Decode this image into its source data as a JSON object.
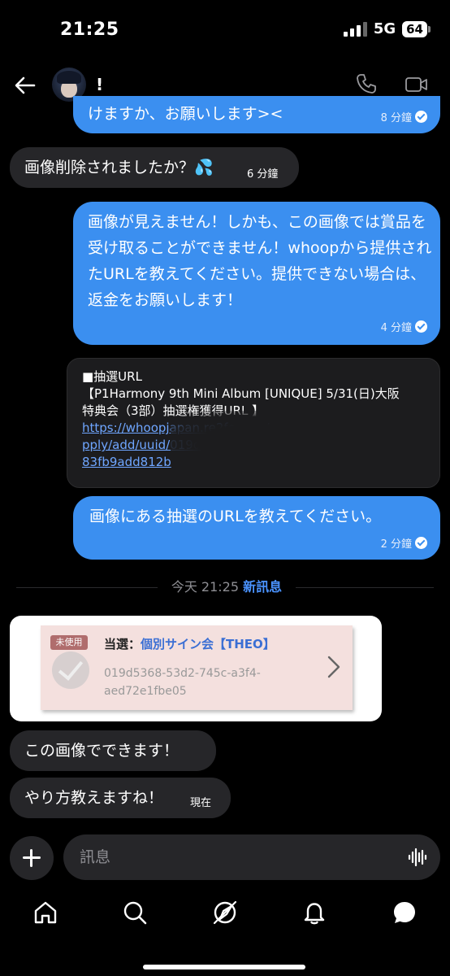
{
  "status_bar": {
    "time": "21:25",
    "network": "5G",
    "battery": "64"
  },
  "header": {
    "contact_name": "!"
  },
  "messages": [
    {
      "from": "me",
      "text": "けますか、お願いします><",
      "time": "8 分鐘"
    },
    {
      "from": "them",
      "text": "画像削除されましたか？💦",
      "time": "6 分鐘"
    },
    {
      "from": "me",
      "text": "画像が見えません！しかも、この画像では賞品を受け取ることができません！whoopから提供されたURLを教えてください。提供できない場合は、返金をお願いします！",
      "time": "4 分鐘"
    },
    {
      "from": "me",
      "text": "画像にある抽選のURLを教えてください。",
      "time": "2 分鐘"
    },
    {
      "from": "them",
      "text": "この画像でできます！"
    },
    {
      "from": "them",
      "text": "やり方教えますね！",
      "time": "現在"
    }
  ],
  "link_card": {
    "line1": "■抽選URL",
    "line2": "【P1Harmony 9th Mini Album [UNIQUE] 5/31(日)大阪",
    "line3": "特典会（3部）抽選権獲得URL 】",
    "url1": "https://whoopjapan.re2fo.com/a",
    "url2": "pply/add/uuid/019d5",
    "url3": "83fb9add812b"
  },
  "divider": {
    "time": "今天 21:25",
    "label": "新訊息"
  },
  "image_message": {
    "tag": "未使用",
    "win_label": "当選：",
    "win_event": "個別サイン会【THEO】",
    "uuid": "019d5368-53d2-745c-a3f4-aed72e1fbe05"
  },
  "composer": {
    "placeholder": "訊息"
  },
  "tab_bar": [
    "home-icon",
    "search-icon",
    "explore-icon",
    "notifications-icon",
    "messages-icon"
  ],
  "colors": {
    "outgoing": "#3b8ff0",
    "incoming": "#262629",
    "link": "#6fa6ff",
    "background": "#000000"
  }
}
